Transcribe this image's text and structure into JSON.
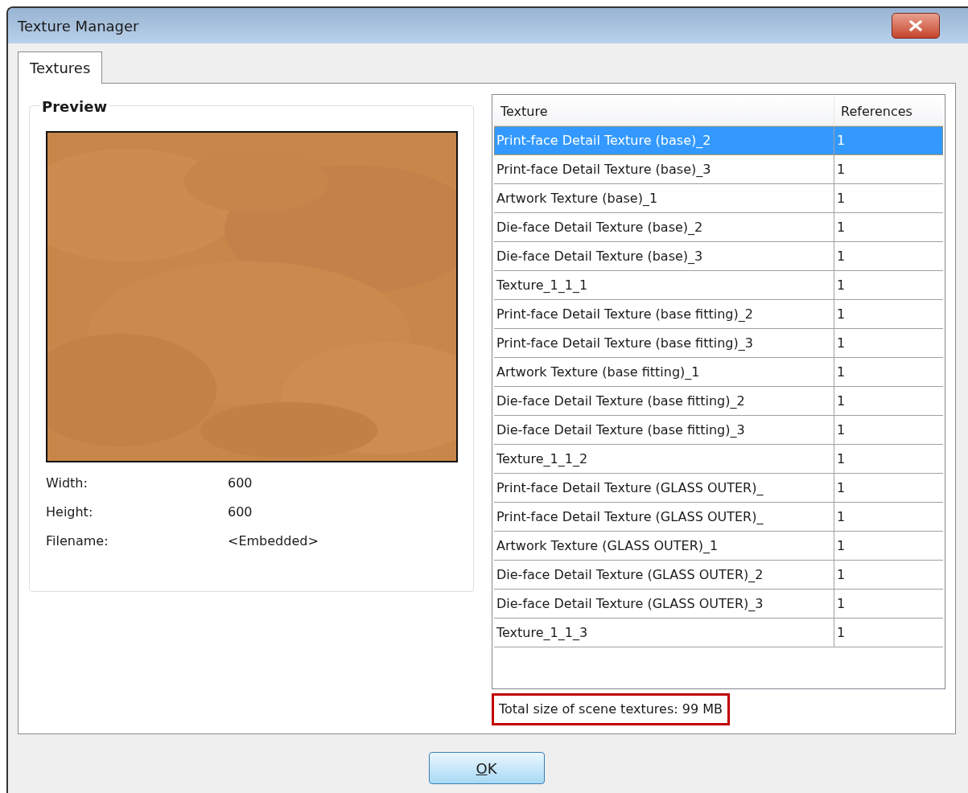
{
  "window": {
    "title": "Texture Manager"
  },
  "tabs": [
    {
      "label": "Textures",
      "selected": true
    }
  ],
  "preview": {
    "title": "Preview",
    "properties": [
      {
        "label": "Width:",
        "value": "600"
      },
      {
        "label": "Height:",
        "value": "600"
      },
      {
        "label": "Filename:",
        "value": "<Embedded>"
      }
    ]
  },
  "table": {
    "columns": [
      "Texture",
      "References"
    ],
    "rows": [
      {
        "texture": "Print-face Detail Texture (base)_2",
        "references": "1",
        "selected": true
      },
      {
        "texture": "Print-face Detail Texture (base)_3",
        "references": "1",
        "selected": false
      },
      {
        "texture": "Artwork Texture (base)_1",
        "references": "1",
        "selected": false
      },
      {
        "texture": "Die-face Detail Texture (base)_2",
        "references": "1",
        "selected": false
      },
      {
        "texture": "Die-face Detail Texture (base)_3",
        "references": "1",
        "selected": false
      },
      {
        "texture": "Texture_1_1_1",
        "references": "1",
        "selected": false
      },
      {
        "texture": "Print-face Detail Texture (base fitting)_2",
        "references": "1",
        "selected": false
      },
      {
        "texture": "Print-face Detail Texture (base fitting)_3",
        "references": "1",
        "selected": false
      },
      {
        "texture": "Artwork Texture (base fitting)_1",
        "references": "1",
        "selected": false
      },
      {
        "texture": "Die-face Detail Texture (base fitting)_2",
        "references": "1",
        "selected": false
      },
      {
        "texture": "Die-face Detail Texture (base fitting)_3",
        "references": "1",
        "selected": false
      },
      {
        "texture": "Texture_1_1_2",
        "references": "1",
        "selected": false
      },
      {
        "texture": "Print-face Detail Texture (GLASS OUTER)_",
        "references": "1",
        "selected": false
      },
      {
        "texture": "Print-face Detail Texture (GLASS OUTER)_",
        "references": "1",
        "selected": false
      },
      {
        "texture": "Artwork Texture (GLASS OUTER)_1",
        "references": "1",
        "selected": false
      },
      {
        "texture": "Die-face Detail Texture (GLASS OUTER)_2",
        "references": "1",
        "selected": false
      },
      {
        "texture": "Die-face Detail Texture (GLASS OUTER)_3",
        "references": "1",
        "selected": false
      },
      {
        "texture": "Texture_1_1_3",
        "references": "1",
        "selected": false
      }
    ]
  },
  "total_size": {
    "text": "Total size of scene textures: 99 MB",
    "highlighted": true
  },
  "buttons": [
    {
      "label": "OK",
      "mnemonic_underlined": true
    }
  ]
}
